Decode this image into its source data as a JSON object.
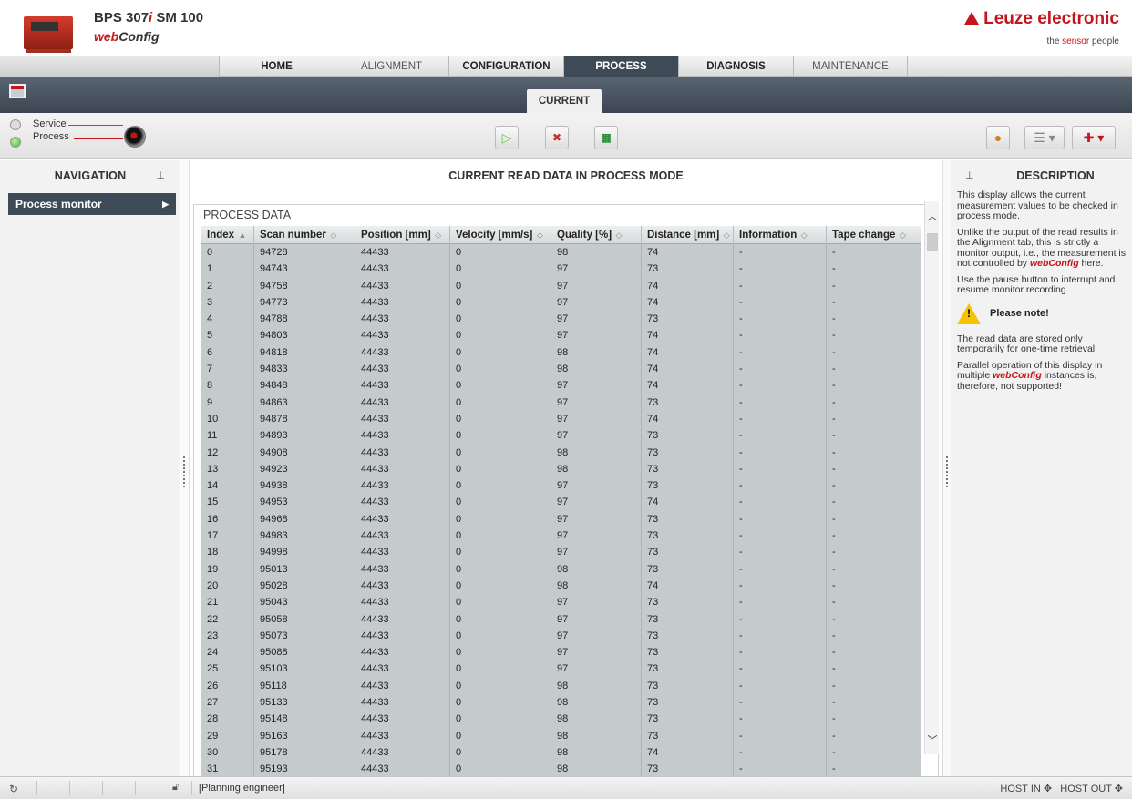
{
  "app": {
    "product_prefix": "BPS 307",
    "product_i": "i",
    "product_suffix": " SM 100",
    "web": "web",
    "config": "Config",
    "brand": "Leuze electronic",
    "tagline_prefix": "the ",
    "tagline_highlight": "sensor",
    "tagline_suffix": " people"
  },
  "tabs": [
    {
      "label": "HOME",
      "state": "normal"
    },
    {
      "label": "ALIGNMENT",
      "state": "dim"
    },
    {
      "label": "CONFIGURATION",
      "state": "normal"
    },
    {
      "label": "PROCESS",
      "state": "active"
    },
    {
      "label": "DIAGNOSIS",
      "state": "normal"
    },
    {
      "label": "MAINTENANCE",
      "state": "dim"
    }
  ],
  "subtab": "CURRENT",
  "mode": {
    "service": "Service",
    "process": "Process"
  },
  "nav": {
    "title": "NAVIGATION",
    "item": "Process monitor"
  },
  "main": {
    "title": "CURRENT READ DATA IN PROCESS MODE",
    "box_title": "PROCESS DATA"
  },
  "table": {
    "columns": [
      "Index",
      "Scan number",
      "Position [mm]",
      "Velocity [mm/s]",
      "Quality [%]",
      "Distance [mm]",
      "Information",
      "Tape change"
    ],
    "rows": [
      [
        "0",
        "94728",
        "44433",
        "0",
        "98",
        "74",
        "-",
        "-"
      ],
      [
        "1",
        "94743",
        "44433",
        "0",
        "97",
        "73",
        "-",
        "-"
      ],
      [
        "2",
        "94758",
        "44433",
        "0",
        "97",
        "74",
        "-",
        "-"
      ],
      [
        "3",
        "94773",
        "44433",
        "0",
        "97",
        "74",
        "-",
        "-"
      ],
      [
        "4",
        "94788",
        "44433",
        "0",
        "97",
        "73",
        "-",
        "-"
      ],
      [
        "5",
        "94803",
        "44433",
        "0",
        "97",
        "74",
        "-",
        "-"
      ],
      [
        "6",
        "94818",
        "44433",
        "0",
        "98",
        "74",
        "-",
        "-"
      ],
      [
        "7",
        "94833",
        "44433",
        "0",
        "98",
        "74",
        "-",
        "-"
      ],
      [
        "8",
        "94848",
        "44433",
        "0",
        "97",
        "74",
        "-",
        "-"
      ],
      [
        "9",
        "94863",
        "44433",
        "0",
        "97",
        "73",
        "-",
        "-"
      ],
      [
        "10",
        "94878",
        "44433",
        "0",
        "97",
        "74",
        "-",
        "-"
      ],
      [
        "11",
        "94893",
        "44433",
        "0",
        "97",
        "73",
        "-",
        "-"
      ],
      [
        "12",
        "94908",
        "44433",
        "0",
        "98",
        "73",
        "-",
        "-"
      ],
      [
        "13",
        "94923",
        "44433",
        "0",
        "98",
        "73",
        "-",
        "-"
      ],
      [
        "14",
        "94938",
        "44433",
        "0",
        "97",
        "73",
        "-",
        "-"
      ],
      [
        "15",
        "94953",
        "44433",
        "0",
        "97",
        "74",
        "-",
        "-"
      ],
      [
        "16",
        "94968",
        "44433",
        "0",
        "97",
        "73",
        "-",
        "-"
      ],
      [
        "17",
        "94983",
        "44433",
        "0",
        "97",
        "73",
        "-",
        "-"
      ],
      [
        "18",
        "94998",
        "44433",
        "0",
        "97",
        "73",
        "-",
        "-"
      ],
      [
        "19",
        "95013",
        "44433",
        "0",
        "98",
        "73",
        "-",
        "-"
      ],
      [
        "20",
        "95028",
        "44433",
        "0",
        "98",
        "74",
        "-",
        "-"
      ],
      [
        "21",
        "95043",
        "44433",
        "0",
        "97",
        "73",
        "-",
        "-"
      ],
      [
        "22",
        "95058",
        "44433",
        "0",
        "97",
        "73",
        "-",
        "-"
      ],
      [
        "23",
        "95073",
        "44433",
        "0",
        "97",
        "73",
        "-",
        "-"
      ],
      [
        "24",
        "95088",
        "44433",
        "0",
        "97",
        "73",
        "-",
        "-"
      ],
      [
        "25",
        "95103",
        "44433",
        "0",
        "97",
        "73",
        "-",
        "-"
      ],
      [
        "26",
        "95118",
        "44433",
        "0",
        "98",
        "73",
        "-",
        "-"
      ],
      [
        "27",
        "95133",
        "44433",
        "0",
        "98",
        "73",
        "-",
        "-"
      ],
      [
        "28",
        "95148",
        "44433",
        "0",
        "98",
        "73",
        "-",
        "-"
      ],
      [
        "29",
        "95163",
        "44433",
        "0",
        "98",
        "73",
        "-",
        "-"
      ],
      [
        "30",
        "95178",
        "44433",
        "0",
        "98",
        "74",
        "-",
        "-"
      ],
      [
        "31",
        "95193",
        "44433",
        "0",
        "98",
        "73",
        "-",
        "-"
      ]
    ]
  },
  "description": {
    "title": "DESCRIPTION",
    "p1": "This display allows the current measurement values to be checked in process mode.",
    "p2_pre": "Unlike the output of the read results in the Alignment tab, this is strictly a monitor output, i.e., the measurement is not controlled by ",
    "p2_em": "webConfig",
    "p2_post": " here.",
    "p3": "Use the pause button to interrupt and resume monitor recording.",
    "note_label": "Please note!",
    "p4": "The read data are stored only temporarily for one-time retrieval.",
    "p5_pre": "Parallel operation of this display in multiple ",
    "p5_em": "webConfig",
    "p5_post": " instances is, therefore, not supported!"
  },
  "status": {
    "user": "[Planning engineer]",
    "host_in": "HOST IN",
    "host_out": "HOST OUT"
  },
  "colors": {
    "brand_red": "#c2151c",
    "nav_dark": "#3f4a57",
    "grid_bg": "#c5cacd"
  }
}
